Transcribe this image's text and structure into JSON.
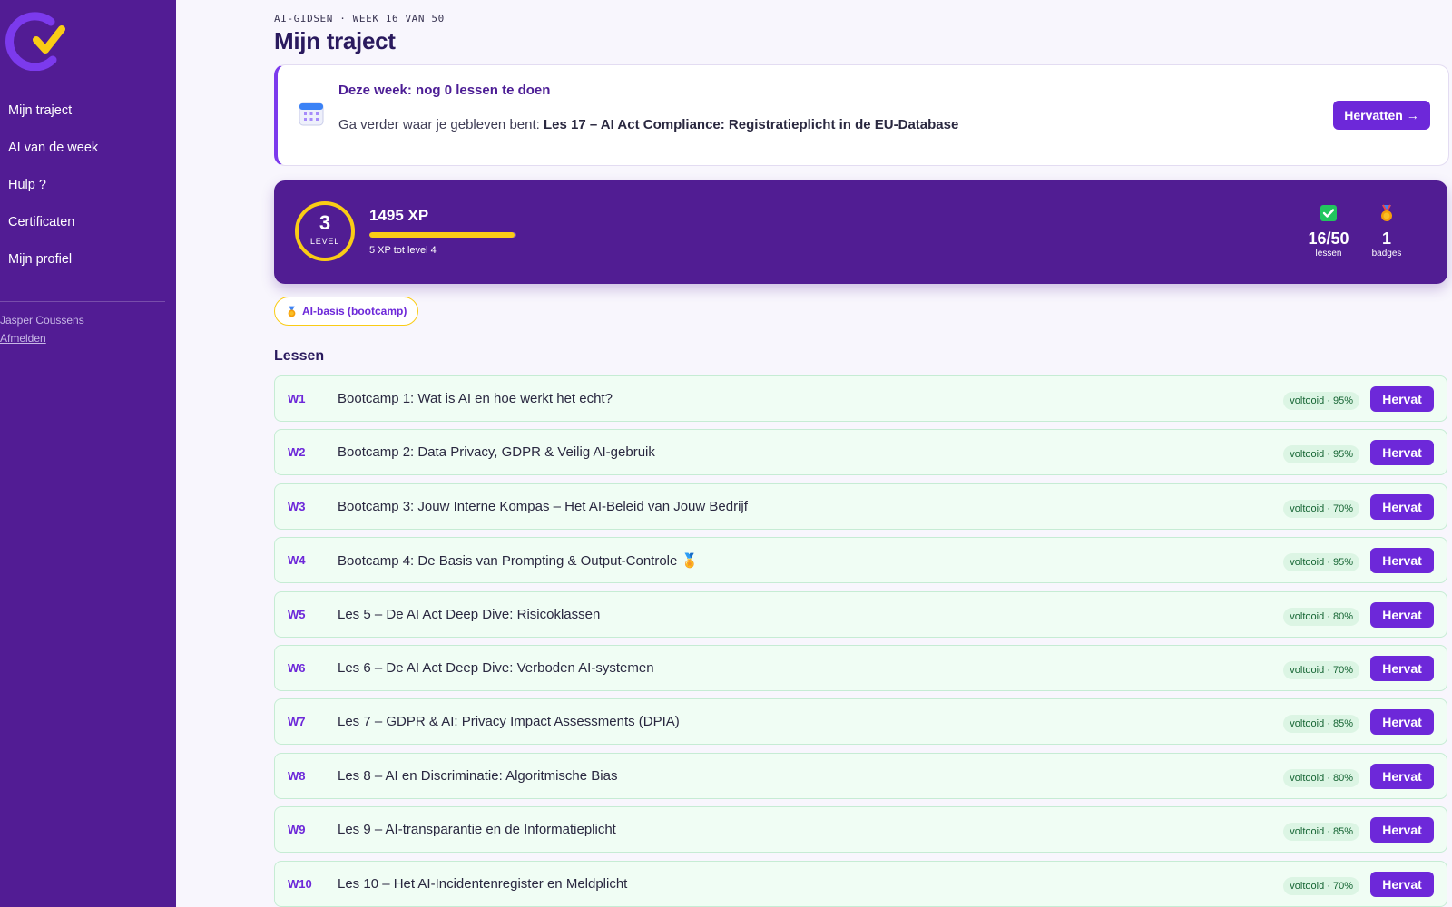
{
  "colors": {
    "sidebar": "#521c94",
    "accent": "#6d28d9",
    "gold": "#facc15",
    "completed": "#f0fdf4"
  },
  "sidebar": {
    "logo_icon": "check-logo-icon",
    "items": [
      {
        "label": "Mijn traject"
      },
      {
        "label": "AI van de week"
      },
      {
        "label": "Hulp ?"
      },
      {
        "label": "Certificaten"
      },
      {
        "label": "Mijn profiel"
      }
    ],
    "user_name": "Jasper Coussens",
    "logout_label": "Afmelden"
  },
  "header": {
    "eyebrow": "AI-GIDSEN · WEEK 16 VAN 50",
    "title": "Mijn traject"
  },
  "week_card": {
    "icon": "calendar-icon",
    "title": "Deze week: nog 0 lessen te doen",
    "desc_prefix": "Ga verder waar je gebleven bent: ",
    "desc_lesson": "Les 17 – AI Act Compliance: Registratieplicht in de EU-Database",
    "button_label": "Hervatten →"
  },
  "progress": {
    "level": "3",
    "level_label": "LEVEL",
    "xp_label": "1495 XP",
    "xp_progress_fraction": 0.99,
    "xp_next_label": "5 XP tot level 4",
    "lessons_value": "16/50",
    "lessons_label": "lessen",
    "lessons_icon": "check-square-icon",
    "badges_value": "1",
    "badges_label": "badges",
    "badges_icon": "medal-icon"
  },
  "badge_filter": {
    "icon": "medal-icon",
    "label": "AI-basis (bootcamp)"
  },
  "lessons": {
    "heading": "Lessen",
    "button_label": "Hervat",
    "items": [
      {
        "week": "W1",
        "title": "Bootcamp 1: Wat is AI en hoe werkt het echt?",
        "status": "voltooid · 95%"
      },
      {
        "week": "W2",
        "title": "Bootcamp 2: Data Privacy, GDPR & Veilig AI-gebruik",
        "status": "voltooid · 95%"
      },
      {
        "week": "W3",
        "title": "Bootcamp 3: Jouw Interne Kompas – Het AI-Beleid van Jouw Bedrijf",
        "status": "voltooid · 70%"
      },
      {
        "week": "W4",
        "title": "Bootcamp 4: De Basis van Prompting & Output-Controle 🏅",
        "status": "voltooid · 95%"
      },
      {
        "week": "W5",
        "title": "Les 5 – De AI Act Deep Dive: Risicoklassen",
        "status": "voltooid · 80%"
      },
      {
        "week": "W6",
        "title": "Les 6 – De AI Act Deep Dive: Verboden AI-systemen",
        "status": "voltooid · 70%"
      },
      {
        "week": "W7",
        "title": "Les 7 – GDPR & AI: Privacy Impact Assessments (DPIA)",
        "status": "voltooid · 85%"
      },
      {
        "week": "W8",
        "title": "Les 8 – AI en Discriminatie: Algoritmische Bias",
        "status": "voltooid · 80%"
      },
      {
        "week": "W9",
        "title": "Les 9 – AI-transparantie en de Informatieplicht",
        "status": "voltooid · 85%"
      },
      {
        "week": "W10",
        "title": "Les 10 – Het AI-Incidentenregister en Meldplicht",
        "status": "voltooid · 70%"
      }
    ]
  }
}
